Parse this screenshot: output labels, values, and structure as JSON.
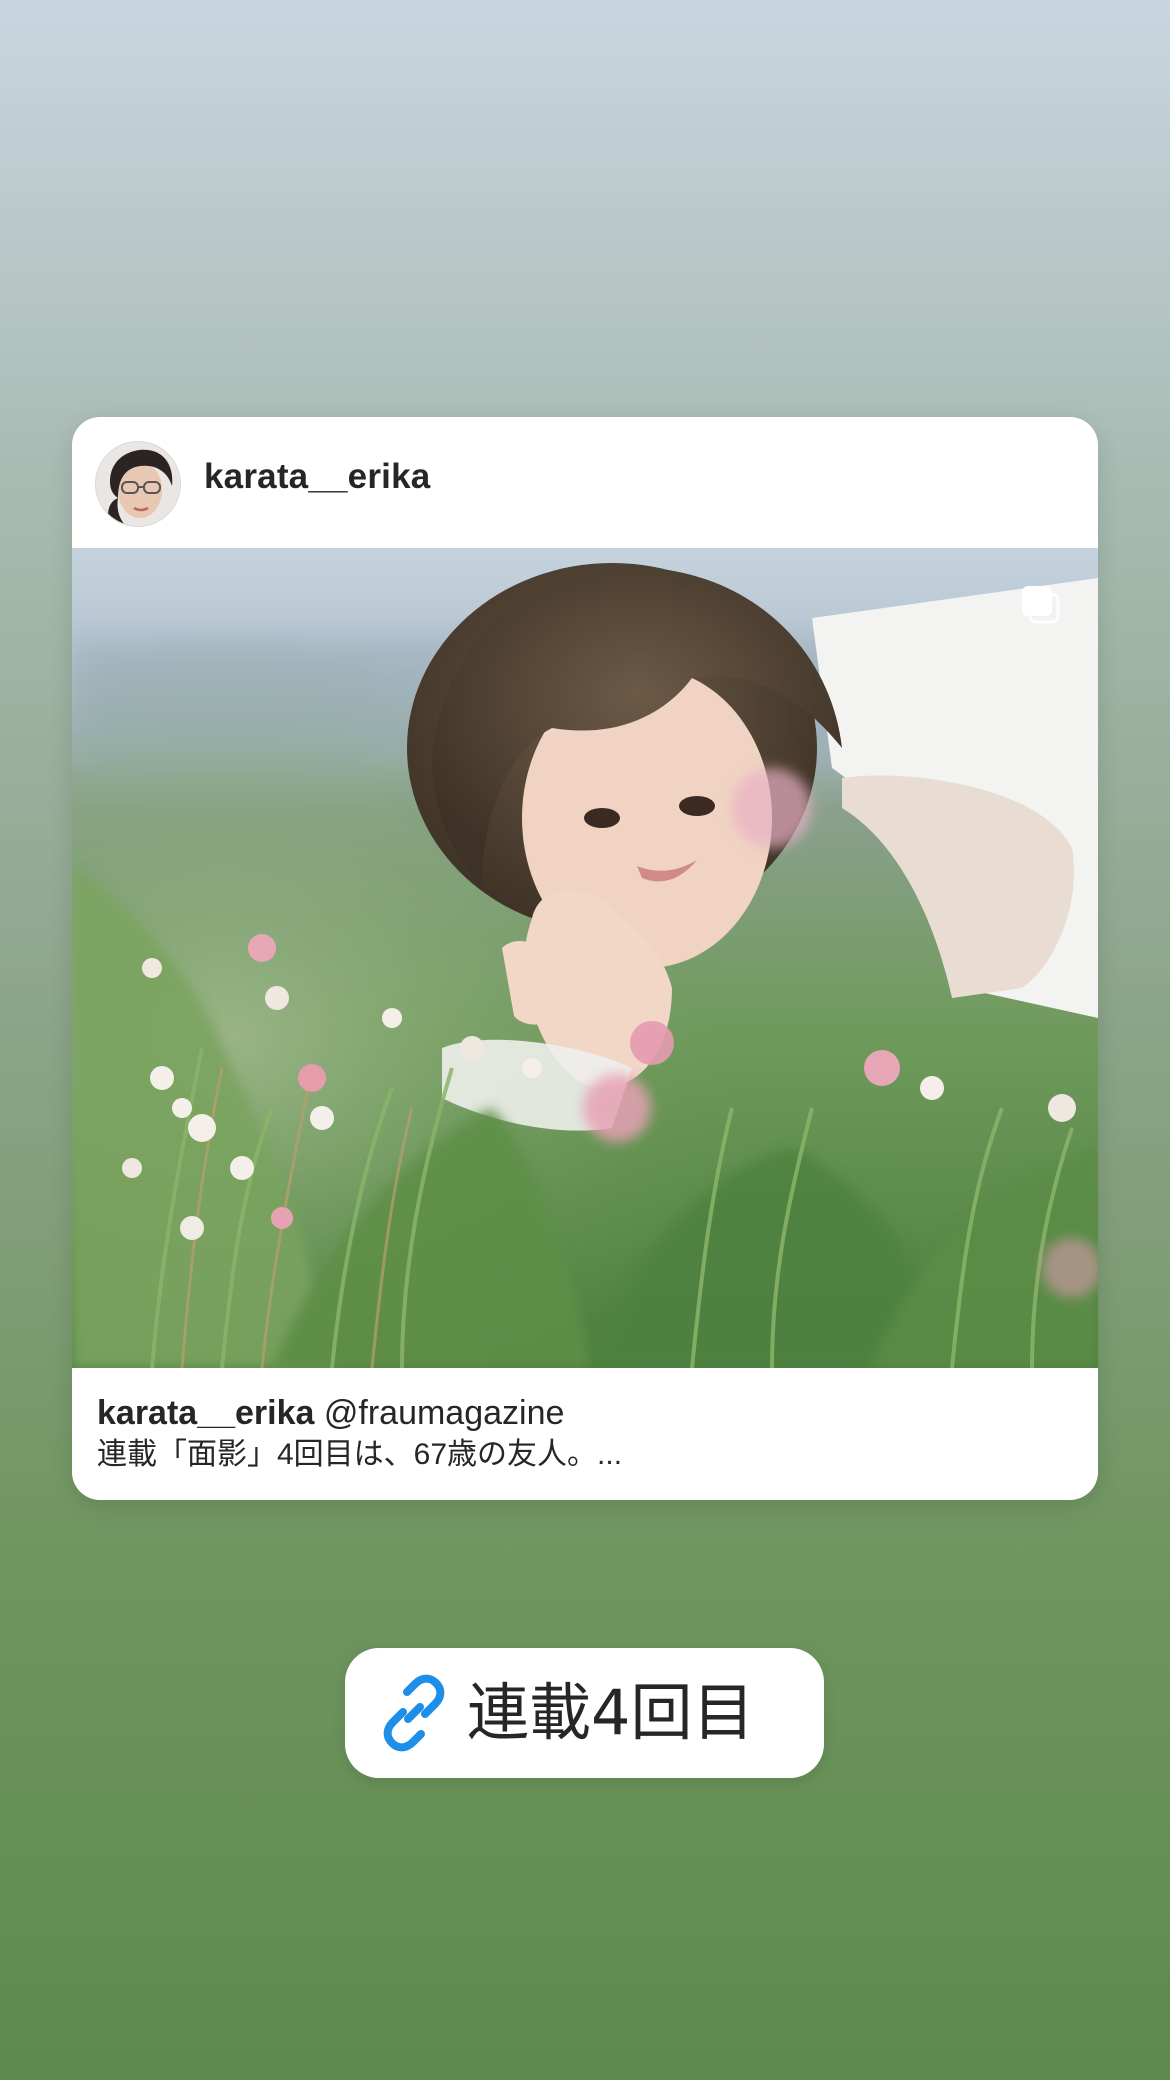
{
  "post": {
    "username": "karata__erika",
    "caption_username": "karata__erika",
    "caption_mention": "@fraumagazine",
    "caption_text": "連載「面影」4回目は、67歳の友人。..."
  },
  "link_sticker": {
    "label": "連載4回目",
    "icon": "link-icon",
    "icon_color": "#1e8fe8"
  },
  "colors": {
    "background_top": "#c9d6e0",
    "background_bottom": "#5e8a4d",
    "card": "#ffffff"
  }
}
